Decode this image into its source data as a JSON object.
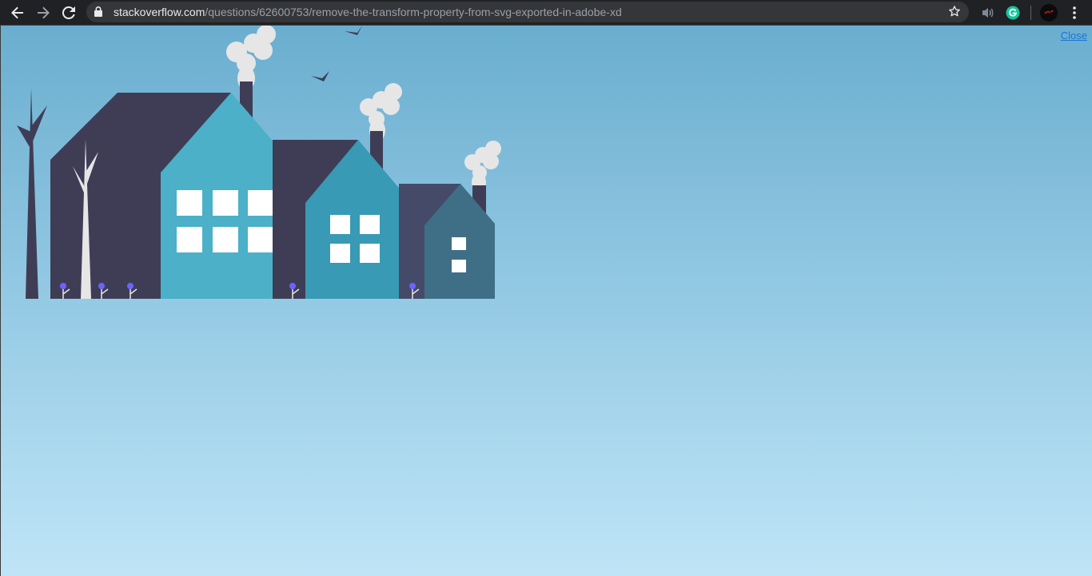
{
  "browser": {
    "url_domain": "stackoverflow.com",
    "url_path": "/questions/62600753/remove-the-transform-property-from-svg-exported-in-adobe-xd",
    "icons": {
      "back": "arrow-left-icon",
      "forward": "arrow-right-icon",
      "reload": "reload-icon",
      "lock": "lock-icon",
      "bookmark": "star-icon",
      "audio": "speaker-icon",
      "grammarly": "grammarly-icon",
      "profile": "avatar",
      "menu": "kebab-menu-icon"
    }
  },
  "page": {
    "close_label": "Close"
  },
  "colors": {
    "sky_top": "#6aaecf",
    "sky_bottom": "#bfe4f6",
    "building_dark": "#3f3d56",
    "house_teal": "#4bb0c8",
    "house_mid": "#389ab5",
    "house_slate": "#3f6f86",
    "smoke": "#e6e6e6",
    "flower": "#6c63ff",
    "link": "#1a73d9"
  }
}
